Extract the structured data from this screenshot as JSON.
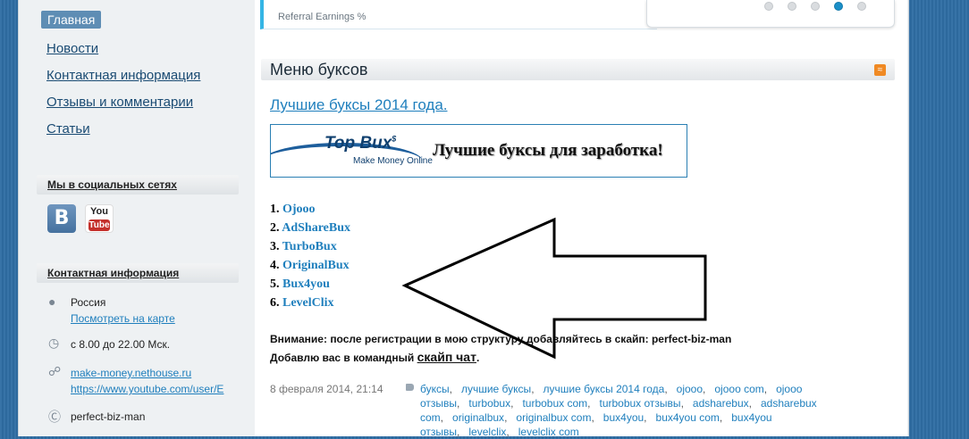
{
  "nav": {
    "active": "Главная",
    "items": [
      "Новости",
      "Контактная информация",
      "Отзывы и комментарии",
      "Статьи"
    ]
  },
  "social": {
    "heading": "Мы в социальных сетях",
    "vk_glyph": "B",
    "yt_you": "You",
    "yt_tube": "Tube"
  },
  "contact": {
    "heading": "Контактная информация",
    "country": "Россия",
    "map_link": "Посмотреть на карте",
    "hours": "с 8.00 до 22.00 Мск.",
    "site": "make-money.nethouse.ru",
    "youtube": "https://www.youtube.com/user/E",
    "skype": "perfect-biz-man"
  },
  "widget": {
    "referral_label": "Referral Earnings %",
    "active_dot_index": 3,
    "dot_count": 5
  },
  "section": {
    "title": "Меню буксов"
  },
  "post": {
    "title": "Лучшие буксы 2014 года.",
    "banner_logo": "Top Bux",
    "banner_logo_sup": "$",
    "banner_slogan": "Make Money Online",
    "banner_tagline": "Лучшие буксы для заработка!",
    "list": [
      {
        "num": "1.",
        "name": "Ojooo"
      },
      {
        "num": "2.",
        "name": "AdShareBux"
      },
      {
        "num": "3.",
        "name": "TurboBux"
      },
      {
        "num": "4.",
        "name": "OriginalBux"
      },
      {
        "num": "5.",
        "name": "Bux4you"
      },
      {
        "num": "6.",
        "name": "LevelClix"
      }
    ],
    "notice_line1": "Внимание: после регистрации в мою структуру добавляйтесь в скайп: perfect-biz-man",
    "notice_line2_prefix": "Добавлю вас в командный ",
    "notice_chat": "скайп чат",
    "notice_line2_suffix": ".",
    "date": "8 февраля 2014, 21:14",
    "tags": [
      "буксы",
      "лучшие буксы",
      "лучшие буксы 2014 года",
      "ojooo",
      "ojooo com",
      "ojooo отзывы",
      "turbobux",
      "turbobux com",
      "turbobux отзывы",
      "adsharebux",
      "adsharebux com",
      "originalbux",
      "originalbux com",
      "bux4you",
      "bux4you com",
      "bux4you отзывы",
      "levelclix",
      "levelclix com"
    ]
  },
  "icons": {
    "location": "location-pin-icon",
    "clock": "clock-icon",
    "link": "link-icon",
    "skype": "skype-icon",
    "rss": "rss-icon",
    "tag": "tag-icon"
  },
  "colors": {
    "link": "#1f7fbd",
    "nav_active_bg": "#5e8db4",
    "page_bg": "#2f6da3",
    "widget_accent": "#35b5e5",
    "active_dot": "#1b8fc8",
    "rss": "#f08a24"
  }
}
